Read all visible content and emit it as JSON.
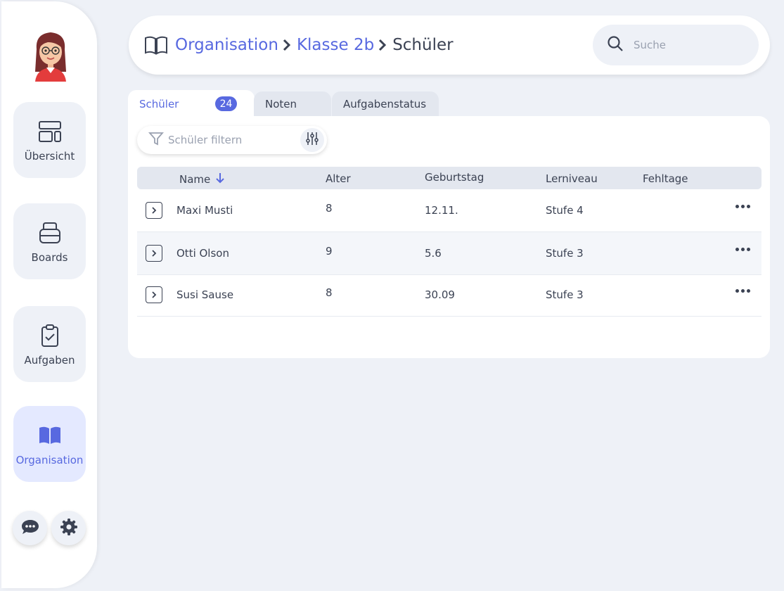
{
  "sidebar": {
    "items": [
      {
        "label": "Übersicht",
        "icon": "layout-icon",
        "active": false
      },
      {
        "label": "Boards",
        "icon": "stack-icon",
        "active": false
      },
      {
        "label": "Aufgaben",
        "icon": "clipboard-check-icon",
        "active": false
      },
      {
        "label": "Organisation",
        "icon": "book-icon",
        "active": true
      }
    ],
    "bottom": [
      "chat-icon",
      "gear-icon"
    ]
  },
  "header": {
    "breadcrumb": [
      "Organisation",
      "Klasse 2b",
      "Schüler"
    ],
    "search_placeholder": "Suche"
  },
  "tabs": [
    {
      "label": "Schüler",
      "badge": "24",
      "active": true
    },
    {
      "label": "Noten",
      "active": false
    },
    {
      "label": "Aufgabenstatus",
      "active": false
    }
  ],
  "filter": {
    "placeholder": "Schüler filtern"
  },
  "table": {
    "columns": [
      "Name",
      "Alter",
      "Geburtstag",
      "Lerniveau",
      "Fehltage"
    ],
    "rows": [
      {
        "name": "Maxi Musti",
        "alter": "8",
        "geburtstag": "12.11.",
        "lerniveau": "Stufe 4",
        "fehltage": ""
      },
      {
        "name": "Otti Olson",
        "alter": "9",
        "geburtstag": "5.6",
        "lerniveau": "Stufe 3",
        "fehltage": ""
      },
      {
        "name": "Susi Sause",
        "alter": "8",
        "geburtstag": "30.09",
        "lerniveau": "Stufe 3",
        "fehltage": ""
      }
    ]
  },
  "colors": {
    "accent": "#5869e0",
    "text": "#3b4253",
    "background": "#eef1f7"
  }
}
